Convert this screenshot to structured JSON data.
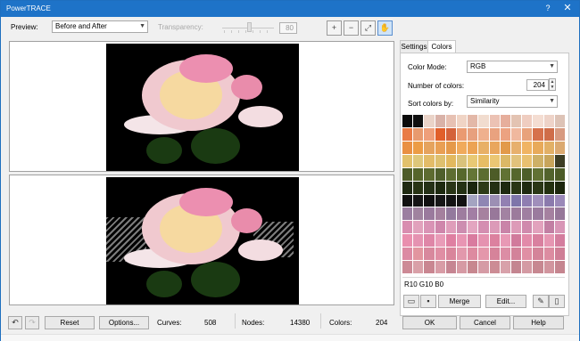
{
  "window": {
    "title": "PowerTRACE",
    "help_glyph": "?",
    "close_glyph": "✕"
  },
  "toolbar": {
    "preview_label": "Preview:",
    "preview_value": "Before and After",
    "transparency_label": "Transparency:",
    "transparency_value": "80",
    "zoom_in_glyph": "+",
    "zoom_out_glyph": "−",
    "fit_glyph": "⤢",
    "pan_glyph": "✋"
  },
  "tabs": [
    {
      "label": "Settings",
      "active": false
    },
    {
      "label": "Colors",
      "active": true
    }
  ],
  "colors_panel": {
    "color_mode_label": "Color Mode:",
    "color_mode_value": "RGB",
    "number_of_colors_label": "Number of colors:",
    "number_of_colors_value": "204",
    "sort_colors_label": "Sort colors by:",
    "sort_colors_value": "Similarity",
    "selected_color": "R10 G10 B0",
    "merge_label": "Merge",
    "edit_label": "Edit...",
    "palette_rows": [
      [
        "#0b0b0b",
        "#101010",
        "#ead3c8",
        "#d9b2a8",
        "#e7c1b3",
        "#f0d4c5",
        "#e3b8a8",
        "#f1dccf",
        "#ecc2b4",
        "#e6ae9c",
        "#e3c3b2",
        "#efcdc0",
        "#f4ddd2",
        "#eed3c8",
        "#ddc3b6"
      ],
      [
        "#e97b46",
        "#e89a6e",
        "#ef9f7a",
        "#e15f2a",
        "#d4623a",
        "#ea9a71",
        "#e7a07e",
        "#efb08e",
        "#e9a27f",
        "#eca281",
        "#f0b89e",
        "#e8a27b",
        "#d6714c",
        "#cf6d49",
        "#d79a80"
      ],
      [
        "#e99043",
        "#ec9c45",
        "#e5a35e",
        "#e99f54",
        "#e5994a",
        "#f0aa5c",
        "#eca354",
        "#e8b066",
        "#e9a65d",
        "#e29a4a",
        "#e7b06d",
        "#f0b463",
        "#e8aa5a",
        "#e2b066",
        "#dba970"
      ],
      [
        "#e2c16b",
        "#dec77a",
        "#e3bc68",
        "#dec06f",
        "#e2b95f",
        "#d9c27b",
        "#e8c975",
        "#e7bd65",
        "#ebc774",
        "#dbb866",
        "#e1c27c",
        "#e8c070",
        "#ceb066",
        "#c8a55b",
        "#3d3d24"
      ],
      [
        "#4e5c29",
        "#56652b",
        "#5d6b30",
        "#4f5f2c",
        "#5e6d32",
        "#57682c",
        "#647536",
        "#5c6d30",
        "#4d5c27",
        "#617233",
        "#56672d",
        "#4d5e29",
        "#617134",
        "#52632c",
        "#4c5b27"
      ],
      [
        "#1f2a12",
        "#283414",
        "#253117",
        "#1e2a10",
        "#2a3617",
        "#243114",
        "#1a250e",
        "#2d3a18",
        "#243014",
        "#1e2911",
        "#293515",
        "#1f2a10",
        "#2b3716",
        "#23300f",
        "#1c260d"
      ],
      [
        "#101010",
        "#141414",
        "#0f0f0f",
        "#161616",
        "#131313",
        "#121212",
        "#a4a4c1",
        "#8f86b3",
        "#9c8fb4",
        "#9280b2",
        "#7e75aa",
        "#8f7eb1",
        "#a08fbb",
        "#8b7aad",
        "#9a88b8"
      ],
      [
        "#9b7ea0",
        "#a0839f",
        "#9a7a9d",
        "#a4809e",
        "#93799d",
        "#9e7c9f",
        "#a27ea4",
        "#a6819f",
        "#98789a",
        "#a282a2",
        "#9c7b9c",
        "#9f7fa1",
        "#9a7b9e",
        "#a581a0",
        "#967799"
      ],
      [
        "#d98eb0",
        "#e1a1bc",
        "#d993b5",
        "#cf86ab",
        "#df9dba",
        "#cd8db0",
        "#e3a5c0",
        "#d48eb1",
        "#dc9ab8",
        "#c984a8",
        "#dd9bb8",
        "#d08aad",
        "#e2a2bd",
        "#c27fa3",
        "#d896b6"
      ],
      [
        "#e98fae",
        "#e592b1",
        "#df86a7",
        "#e99cb8",
        "#df7fa1",
        "#e895b3",
        "#d97b9f",
        "#e592b0",
        "#dc819f",
        "#e899b5",
        "#d17a9c",
        "#e28aa9",
        "#d9809f",
        "#e696b2",
        "#d47d9e"
      ],
      [
        "#dc8aa3",
        "#e2959f",
        "#d8889d",
        "#e08ea4",
        "#d9859b",
        "#e298ac",
        "#dd8aa0",
        "#e497ab",
        "#d6839a",
        "#dc8da5",
        "#d3829a",
        "#e08fa4",
        "#d48499",
        "#dc8ca1",
        "#cf7e96"
      ],
      [
        "#cd8a96",
        "#d9a0a8",
        "#c98691",
        "#d89ca6",
        "#c68592",
        "#d69aa4",
        "#c7878f",
        "#d59ba5",
        "#cc8c95",
        "#d8a1aa",
        "#c48590",
        "#d49aa3",
        "#c78891",
        "#d1959e",
        "#c5858f"
      ]
    ]
  },
  "footer": {
    "reset_label": "Reset",
    "options_label": "Options...",
    "curves_label": "Curves:",
    "curves_value": "508",
    "nodes_label": "Nodes:",
    "nodes_value": "14380",
    "colors_label": "Colors:",
    "colors_value": "204",
    "ok_label": "OK",
    "cancel_label": "Cancel",
    "help_label": "Help",
    "undo_glyph": "↶",
    "redo_glyph": "↷"
  }
}
